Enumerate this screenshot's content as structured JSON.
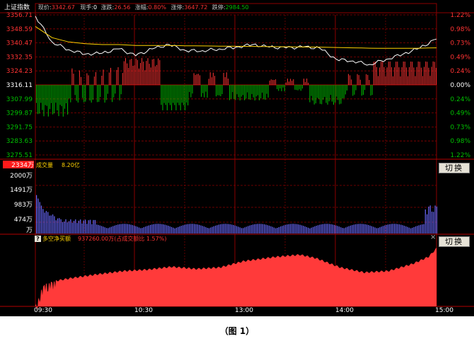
{
  "header": {
    "index_name": "上证指数",
    "price_label": "现价:",
    "price_value": "3342.67",
    "hand_label": "现手:",
    "hand_value": "0",
    "change_label": "涨跌:",
    "change_value": "26.56",
    "pct_label": "涨幅:",
    "pct_value": "0.80%",
    "limit_up_label": "涨停:",
    "limit_up_value": "3647.72",
    "limit_down_label": "跌停:",
    "limit_down_value": "2984.50"
  },
  "price_axis": {
    "left": [
      "3356.71",
      "3348.59",
      "3340.47",
      "3332.35",
      "3324.23",
      "3316.11",
      "3307.99",
      "3299.87",
      "3291.75",
      "3283.63",
      "3275.51"
    ],
    "right": [
      "1.22%",
      "0.98%",
      "0.73%",
      "0.49%",
      "0.24%",
      "0.00%",
      "0.24%",
      "0.49%",
      "0.73%",
      "0.98%",
      "1.22%"
    ],
    "prev_close": 3316.11,
    "max": 3356.71,
    "min": 3275.51
  },
  "volume_panel": {
    "title": "成交量",
    "value": "8.20亿",
    "axis_labels": [
      "2334万",
      "2000万",
      "1491万",
      "983万",
      "474万",
      "万"
    ],
    "axis_max": 2334,
    "switch_label": "切换"
  },
  "netflow_panel": {
    "icon": "?",
    "title": "多空净买额",
    "value": "937260.00万(占成交额比 1.57%)",
    "switch_label": "切换"
  },
  "time_axis": [
    "09:30",
    "10:30",
    "13:00",
    "14:00",
    "15:00"
  ],
  "caption": "（图 1）",
  "colors": {
    "background": "#000000",
    "grid": "#8b0000",
    "price_line": "#ffffff",
    "avg_line": "#ffd200",
    "up": "#ff3333",
    "down": "#00c000",
    "netflow_fill": "#ff3a3a",
    "volume_bars": "#6a6aff"
  },
  "chart_data": {
    "type": "line",
    "x": [
      "09:30",
      "09:40",
      "09:50",
      "10:00",
      "10:10",
      "10:20",
      "10:30",
      "10:40",
      "10:50",
      "11:00",
      "11:10",
      "11:20",
      "11:30",
      "13:10",
      "13:20",
      "13:30",
      "13:40",
      "13:50",
      "14:00",
      "14:10",
      "14:20",
      "14:30",
      "14:40",
      "14:50",
      "15:00"
    ],
    "series": [
      {
        "values": [
          3356.0,
          3341.0,
          3336.5,
          3334.0,
          3334.5,
          3337.0,
          3333.0,
          3337.0,
          3339.5,
          3336.0,
          3336.0,
          3337.0,
          3338.0,
          3339.5,
          3338.0,
          3337.5,
          3338.0,
          3337.5,
          3331.0,
          3330.0,
          3328.0,
          3331.0,
          3334.0,
          3337.5,
          3342.67
        ]
      },
      {
        "values": [
          3350.0,
          3343.5,
          3341.0,
          3340.0,
          3339.5,
          3339.5,
          3339.0,
          3339.0,
          3339.0,
          3338.8,
          3338.7,
          3338.6,
          3338.5,
          3338.4,
          3338.3,
          3338.2,
          3338.1,
          3338.0,
          3337.8,
          3337.6,
          3337.4,
          3337.3,
          3337.3,
          3337.4,
          3337.6
        ]
      }
    ],
    "ylim": [
      3275.51,
      3356.71
    ]
  }
}
